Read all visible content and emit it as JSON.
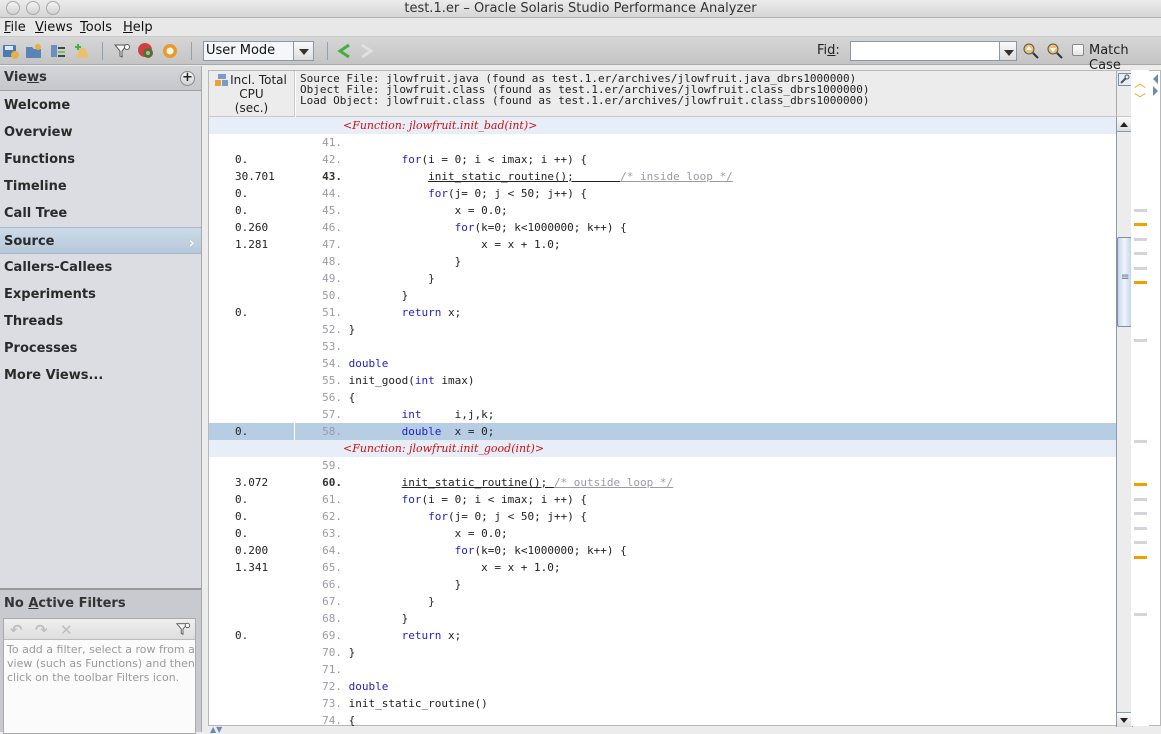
{
  "window": {
    "title": "test.1.er  –  Oracle Solaris Studio Performance Analyzer"
  },
  "menubar": {
    "items": [
      {
        "label": "File",
        "mnemonic": "F"
      },
      {
        "label": "Views",
        "mnemonic": "V"
      },
      {
        "label": "Tools",
        "mnemonic": "T"
      },
      {
        "label": "Help",
        "mnemonic": "H"
      }
    ]
  },
  "toolbar": {
    "icons": [
      "save-experiment-icon",
      "open-experiment-icon",
      "compare-experiments-icon",
      "add-experiment-icon",
      "filter-icon",
      "remote-host-icon",
      "settings-icon"
    ],
    "mode_select": {
      "value": "User Mode"
    },
    "back_icon": "back-arrow-icon",
    "forward_icon": "forward-arrow-icon",
    "find_label": "Find:",
    "find_mnemonic": "d",
    "find_value": "",
    "find_prev_icon": "find-previous-icon",
    "find_next_icon": "find-next-icon",
    "match_case_label": "Match Case",
    "match_case_checked": false
  },
  "sidebar": {
    "header": "Views",
    "header_mnemonic": "w",
    "items": [
      {
        "label": "Welcome",
        "active": false
      },
      {
        "label": "Overview",
        "active": false
      },
      {
        "label": "Functions",
        "active": false
      },
      {
        "label": "Timeline",
        "active": false
      },
      {
        "label": "Call Tree",
        "active": false
      },
      {
        "label": "Source",
        "active": true
      },
      {
        "label": "Callers-Callees",
        "active": false
      },
      {
        "label": "Experiments",
        "active": false
      },
      {
        "label": "Threads",
        "active": false
      },
      {
        "label": "Processes",
        "active": false
      },
      {
        "label": "More Views...",
        "active": false
      }
    ]
  },
  "filters": {
    "title": "No Active Filters",
    "title_mnemonic": "A",
    "hint": "To add a filter, select a row from a view (such as Functions) and then click on the toolbar Filters icon."
  },
  "source_view": {
    "column_header": [
      "Incl. Total",
      "CPU",
      "(sec.)"
    ],
    "file_info": [
      "Source File: jlowfruit.java (found as test.1.er/archives/jlowfruit.java_dbrs1000000)",
      "Object File: jlowfruit.class (found as test.1.er/archives/jlowfruit.class_dbrs1000000)",
      "Load Object: jlowfruit.class (found as test.1.er/archives/jlowfruit.class_dbrs1000000)"
    ],
    "rows": [
      {
        "type": "func",
        "text": "<Function: jlowfruit.init_bad(int)>"
      },
      {
        "metric": "",
        "ln": "41.",
        "code": []
      },
      {
        "metric": "0.",
        "ln": "42.",
        "code": [
          [
            "",
            "        "
          ],
          [
            "kw",
            "for"
          ],
          [
            "",
            "(i = 0; i < imax; i ++) {"
          ]
        ]
      },
      {
        "metric": "30.701",
        "ln": "43.",
        "hot": true,
        "code": [
          [
            "",
            "            "
          ],
          [
            "ul",
            "init_static_routine();       "
          ],
          [
            "ul cm",
            "/* inside loop */"
          ]
        ]
      },
      {
        "metric": "0.",
        "ln": "44.",
        "code": [
          [
            "",
            "            "
          ],
          [
            "kw",
            "for"
          ],
          [
            "",
            "(j= 0; j < 50; j++) {"
          ]
        ]
      },
      {
        "metric": "0.",
        "ln": "45.",
        "code": [
          [
            "",
            "                x = 0.0;"
          ]
        ]
      },
      {
        "metric": "0.260",
        "ln": "46.",
        "code": [
          [
            "",
            "                "
          ],
          [
            "kw",
            "for"
          ],
          [
            "",
            "(k=0; k<1000000; k++) {"
          ]
        ]
      },
      {
        "metric": "1.281",
        "ln": "47.",
        "code": [
          [
            "",
            "                    x = x + 1.0;"
          ]
        ]
      },
      {
        "metric": "",
        "ln": "48.",
        "code": [
          [
            "",
            "                }"
          ]
        ]
      },
      {
        "metric": "",
        "ln": "49.",
        "code": [
          [
            "",
            "            }"
          ]
        ]
      },
      {
        "metric": "",
        "ln": "50.",
        "code": [
          [
            "",
            "        }"
          ]
        ]
      },
      {
        "metric": "0.",
        "ln": "51.",
        "code": [
          [
            "",
            "        "
          ],
          [
            "kw",
            "return"
          ],
          [
            "",
            " x;"
          ]
        ]
      },
      {
        "metric": "",
        "ln": "52.",
        "code": [
          [
            "",
            "}"
          ]
        ]
      },
      {
        "metric": "",
        "ln": "53.",
        "code": []
      },
      {
        "metric": "",
        "ln": "54.",
        "code": [
          [
            "kw",
            "double"
          ]
        ]
      },
      {
        "metric": "",
        "ln": "55.",
        "code": [
          [
            "",
            "init_good("
          ],
          [
            "kw",
            "int"
          ],
          [
            "",
            " imax)"
          ]
        ]
      },
      {
        "metric": "",
        "ln": "56.",
        "code": [
          [
            "",
            "{"
          ]
        ]
      },
      {
        "metric": "",
        "ln": "57.",
        "code": [
          [
            "",
            "        "
          ],
          [
            "kw",
            "int"
          ],
          [
            "",
            "     i,j,k;"
          ]
        ]
      },
      {
        "metric": "0.",
        "ln": "58.",
        "selected": true,
        "code": [
          [
            "",
            "        "
          ],
          [
            "kw",
            "double"
          ],
          [
            "",
            "  x = 0;"
          ]
        ]
      },
      {
        "type": "func",
        "text": "<Function: jlowfruit.init_good(int)>"
      },
      {
        "metric": "",
        "ln": "59.",
        "code": []
      },
      {
        "metric": "3.072",
        "ln": "60.",
        "hot": true,
        "code": [
          [
            "",
            "        "
          ],
          [
            "ul",
            "init_static_routine(); "
          ],
          [
            "ul cm",
            "/* outside loop */"
          ]
        ]
      },
      {
        "metric": "0.",
        "ln": "61.",
        "code": [
          [
            "",
            "        "
          ],
          [
            "kw",
            "for"
          ],
          [
            "",
            "(i = 0; i < imax; i ++) {"
          ]
        ]
      },
      {
        "metric": "0.",
        "ln": "62.",
        "code": [
          [
            "",
            "            "
          ],
          [
            "kw",
            "for"
          ],
          [
            "",
            "(j= 0; j < 50; j++) {"
          ]
        ]
      },
      {
        "metric": "0.",
        "ln": "63.",
        "code": [
          [
            "",
            "                x = 0.0;"
          ]
        ]
      },
      {
        "metric": "0.200",
        "ln": "64.",
        "code": [
          [
            "",
            "                "
          ],
          [
            "kw",
            "for"
          ],
          [
            "",
            "(k=0; k<1000000; k++) {"
          ]
        ]
      },
      {
        "metric": "1.341",
        "ln": "65.",
        "code": [
          [
            "",
            "                    x = x + 1.0;"
          ]
        ]
      },
      {
        "metric": "",
        "ln": "66.",
        "code": [
          [
            "",
            "                }"
          ]
        ]
      },
      {
        "metric": "",
        "ln": "67.",
        "code": [
          [
            "",
            "            }"
          ]
        ]
      },
      {
        "metric": "",
        "ln": "68.",
        "code": [
          [
            "",
            "        }"
          ]
        ]
      },
      {
        "metric": "0.",
        "ln": "69.",
        "code": [
          [
            "",
            "        "
          ],
          [
            "kw",
            "return"
          ],
          [
            "",
            " x;"
          ]
        ]
      },
      {
        "metric": "",
        "ln": "70.",
        "code": [
          [
            "",
            "}"
          ]
        ]
      },
      {
        "metric": "",
        "ln": "71.",
        "code": []
      },
      {
        "metric": "",
        "ln": "72.",
        "code": [
          [
            "kw",
            "double"
          ]
        ]
      },
      {
        "metric": "",
        "ln": "73.",
        "code": [
          [
            "",
            "init_static_routine()"
          ]
        ]
      },
      {
        "metric": "",
        "ln": "74.",
        "code": [
          [
            "",
            "{"
          ]
        ]
      }
    ]
  },
  "colors": {
    "selection": "#b7cde3",
    "function_banner_bg": "#e8eef8",
    "function_banner_text": "#cc1111",
    "keyword": "#2222cc",
    "hot_marker": "#f0a000"
  }
}
